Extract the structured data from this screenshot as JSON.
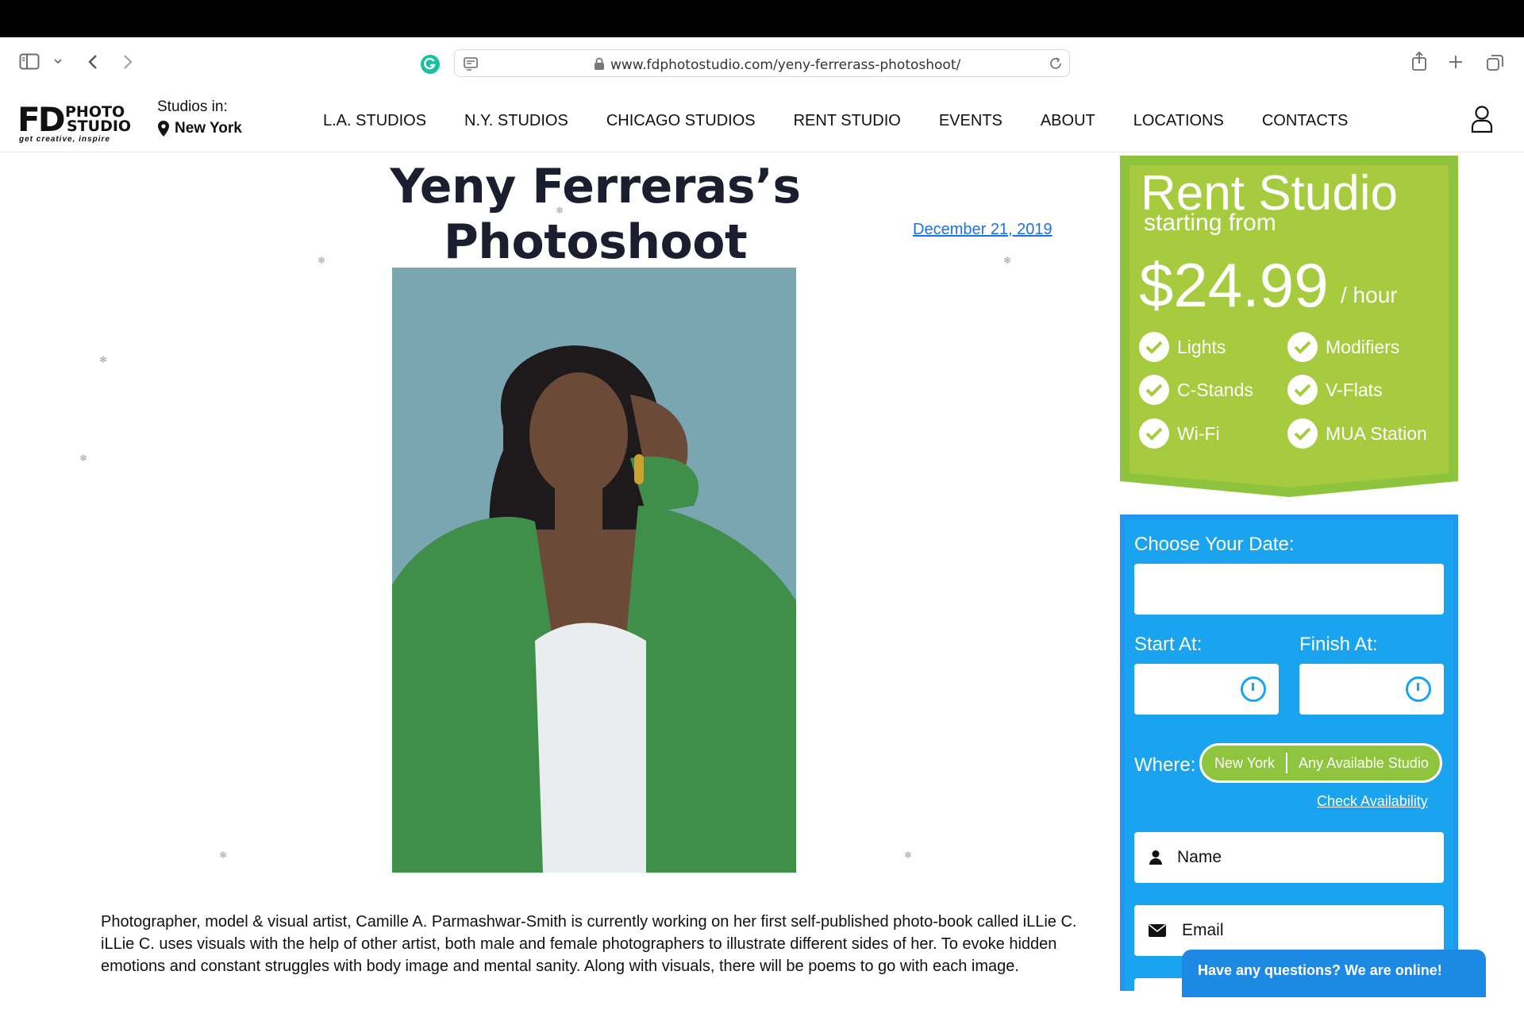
{
  "browser": {
    "url": "www.fdphotostudio.com/yeny-ferrerass-photoshoot/"
  },
  "site": {
    "logo_fd": "FD",
    "logo_photo": "PHOTO",
    "logo_studio": "STUDIO",
    "logo_tagline": "get creative, inspire",
    "studios_in_label": "Studios in:",
    "studios_city": "New York",
    "nav": [
      "L.A. STUDIOS",
      "N.Y. STUDIOS",
      "CHICAGO STUDIOS",
      "RENT STUDIO",
      "EVENTS",
      "ABOUT",
      "LOCATIONS",
      "CONTACTS"
    ]
  },
  "article": {
    "title": "Yeny Ferreras’s Photoshoot",
    "date": "December 21, 2019",
    "body": "Photographer, model & visual artist, Camille A. Parmashwar-Smith is currently working on her first self-published photo-book called iLLie C. iLLie C. uses visuals with the help of other artist, both male and female photographers to illustrate different sides of her. To evoke hidden emotions and constant struggles with body image and mental sanity. Along with visuals, there will be poems to go with each image."
  },
  "rent": {
    "title": "Rent Studio",
    "subtitle": "starting from",
    "price": "$24.99",
    "unit": "/ hour",
    "features": [
      "Lights",
      "Modifiers",
      "C-Stands",
      "V-Flats",
      "Wi-Fi",
      "MUA Station"
    ],
    "accent_color": "#a6cb3f"
  },
  "booking": {
    "date_label": "Choose Your Date:",
    "start_label": "Start At:",
    "finish_label": "Finish At:",
    "where_label": "Where:",
    "where_city": "New York",
    "where_studio": "Any Available Studio",
    "check_availability": "Check Availability",
    "name_placeholder": "Name",
    "email_placeholder": "Email",
    "accent_color": "#1aa3ef"
  },
  "chat": {
    "text": "Have any questions? We are online!"
  }
}
